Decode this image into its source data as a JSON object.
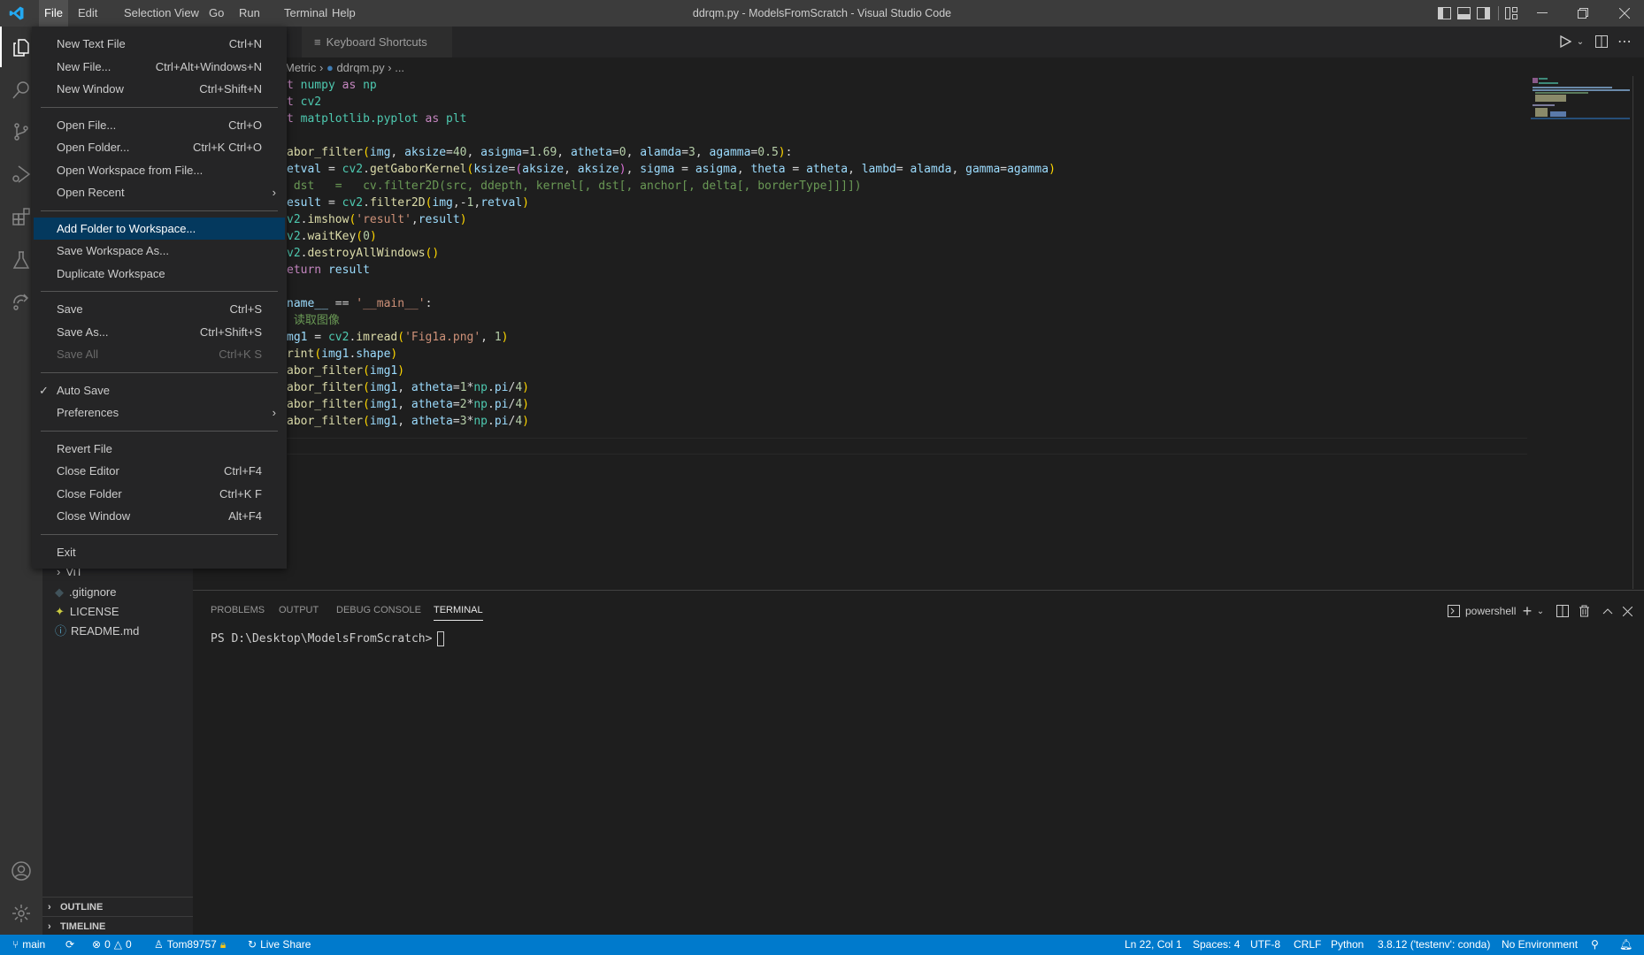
{
  "window": {
    "title": "ddrqm.py - ModelsFromScratch - Visual Studio Code"
  },
  "menubar": [
    "File",
    "Edit",
    "Selection",
    "View",
    "Go",
    "Run",
    "Terminal",
    "Help"
  ],
  "file_menu": [
    {
      "label": "New Text File",
      "shortcut": "Ctrl+N"
    },
    {
      "label": "New File...",
      "shortcut": "Ctrl+Alt+Windows+N"
    },
    {
      "label": "New Window",
      "shortcut": "Ctrl+Shift+N"
    },
    {
      "sep": true
    },
    {
      "label": "Open File...",
      "shortcut": "Ctrl+O"
    },
    {
      "label": "Open Folder...",
      "shortcut": "Ctrl+K Ctrl+O"
    },
    {
      "label": "Open Workspace from File...",
      "shortcut": ""
    },
    {
      "label": "Open Recent",
      "shortcut": "",
      "submenu": true
    },
    {
      "sep": true
    },
    {
      "label": "Add Folder to Workspace...",
      "shortcut": "",
      "highlighted": true
    },
    {
      "label": "Save Workspace As...",
      "shortcut": ""
    },
    {
      "label": "Duplicate Workspace",
      "shortcut": ""
    },
    {
      "sep": true
    },
    {
      "label": "Save",
      "shortcut": "Ctrl+S"
    },
    {
      "label": "Save As...",
      "shortcut": "Ctrl+Shift+S"
    },
    {
      "label": "Save All",
      "shortcut": "Ctrl+K S",
      "disabled": true
    },
    {
      "sep": true
    },
    {
      "label": "Auto Save",
      "shortcut": "",
      "checked": true
    },
    {
      "label": "Preferences",
      "shortcut": "",
      "submenu": true
    },
    {
      "sep": true
    },
    {
      "label": "Revert File",
      "shortcut": ""
    },
    {
      "label": "Close Editor",
      "shortcut": "Ctrl+F4"
    },
    {
      "label": "Close Folder",
      "shortcut": "Ctrl+K F"
    },
    {
      "label": "Close Window",
      "shortcut": "Alt+F4"
    },
    {
      "sep": true
    },
    {
      "label": "Exit",
      "shortcut": ""
    }
  ],
  "sidebar": {
    "items": [
      {
        "label": "ViT",
        "icon": "chevron-right-icon"
      },
      {
        "label": ".gitignore",
        "icon": "git-icon"
      },
      {
        "label": "LICENSE",
        "icon": "license-icon"
      },
      {
        "label": "README.md",
        "icon": "info-icon"
      }
    ],
    "sections": [
      "OUTLINE",
      "TIMELINE"
    ]
  },
  "editor": {
    "tab": "Keyboard Shortcuts",
    "breadcrumb": [
      "Metric",
      "ddrqm.py",
      "..."
    ],
    "lines": [
      [
        [
          "t ",
          "kw"
        ],
        [
          "numpy",
          "mod"
        ],
        [
          " as ",
          "kw"
        ],
        [
          "np",
          "mod"
        ]
      ],
      [
        [
          "t ",
          "kw"
        ],
        [
          "cv2",
          "mod"
        ]
      ],
      [
        [
          "t ",
          "kw"
        ],
        [
          "matplotlib.pyplot",
          "mod"
        ],
        [
          " as ",
          "kw"
        ],
        [
          "plt",
          "mod"
        ]
      ],
      [],
      [
        [
          "abor_filter",
          "fn"
        ],
        [
          "(",
          "b1"
        ],
        [
          "img",
          "var"
        ],
        [
          ", ",
          "op"
        ],
        [
          "aksize",
          "var"
        ],
        [
          "=",
          "op"
        ],
        [
          "40",
          "num"
        ],
        [
          ", ",
          "op"
        ],
        [
          "asigma",
          "var"
        ],
        [
          "=",
          "op"
        ],
        [
          "1.69",
          "num"
        ],
        [
          ", ",
          "op"
        ],
        [
          "atheta",
          "var"
        ],
        [
          "=",
          "op"
        ],
        [
          "0",
          "num"
        ],
        [
          ", ",
          "op"
        ],
        [
          "alamda",
          "var"
        ],
        [
          "=",
          "op"
        ],
        [
          "3",
          "num"
        ],
        [
          ", ",
          "op"
        ],
        [
          "agamma",
          "var"
        ],
        [
          "=",
          "op"
        ],
        [
          "0.5",
          "num"
        ],
        [
          ")",
          "b1"
        ],
        [
          ":",
          "op"
        ]
      ],
      [
        [
          "etval",
          "var"
        ],
        [
          " = ",
          "op"
        ],
        [
          "cv2",
          "mod"
        ],
        [
          ".",
          "op"
        ],
        [
          "getGaborKernel",
          "fn"
        ],
        [
          "(",
          "b1"
        ],
        [
          "ksize",
          "var"
        ],
        [
          "=",
          "op"
        ],
        [
          "(",
          "b2"
        ],
        [
          "aksize",
          "var"
        ],
        [
          ", ",
          "op"
        ],
        [
          "aksize",
          "var"
        ],
        [
          ")",
          "b2"
        ],
        [
          ", ",
          "op"
        ],
        [
          "sigma",
          "var"
        ],
        [
          " = ",
          "op"
        ],
        [
          "asigma",
          "var"
        ],
        [
          ", ",
          "op"
        ],
        [
          "theta",
          "var"
        ],
        [
          " = ",
          "op"
        ],
        [
          "atheta",
          "var"
        ],
        [
          ", ",
          "op"
        ],
        [
          "lambd",
          "var"
        ],
        [
          "= ",
          "op"
        ],
        [
          "alamda",
          "var"
        ],
        [
          ", ",
          "op"
        ],
        [
          "gamma",
          "var"
        ],
        [
          "=",
          "op"
        ],
        [
          "agamma",
          "var"
        ],
        [
          ")",
          "b1"
        ]
      ],
      [
        [
          " dst   =   cv.filter2D(src, ddepth, kernel[, dst[, anchor[, delta[, borderType]]]])",
          "com"
        ]
      ],
      [
        [
          "esult",
          "var"
        ],
        [
          " = ",
          "op"
        ],
        [
          "cv2",
          "mod"
        ],
        [
          ".",
          "op"
        ],
        [
          "filter2D",
          "fn"
        ],
        [
          "(",
          "b1"
        ],
        [
          "img",
          "var"
        ],
        [
          ",-",
          "op"
        ],
        [
          "1",
          "num"
        ],
        [
          ",",
          "op"
        ],
        [
          "retval",
          "var"
        ],
        [
          ")",
          "b1"
        ]
      ],
      [
        [
          "v2",
          "mod"
        ],
        [
          ".",
          "op"
        ],
        [
          "imshow",
          "fn"
        ],
        [
          "(",
          "b1"
        ],
        [
          "'result'",
          "str"
        ],
        [
          ",",
          "op"
        ],
        [
          "result",
          "var"
        ],
        [
          ")",
          "b1"
        ]
      ],
      [
        [
          "v2",
          "mod"
        ],
        [
          ".",
          "op"
        ],
        [
          "waitKey",
          "fn"
        ],
        [
          "(",
          "b1"
        ],
        [
          "0",
          "num"
        ],
        [
          ")",
          "b1"
        ]
      ],
      [
        [
          "v2",
          "mod"
        ],
        [
          ".",
          "op"
        ],
        [
          "destroyAllWindows",
          "fn"
        ],
        [
          "()",
          "b1"
        ]
      ],
      [
        [
          "eturn ",
          "kw"
        ],
        [
          "result",
          "var"
        ]
      ],
      [],
      [
        [
          "name__",
          "var"
        ],
        [
          " == ",
          "op"
        ],
        [
          "'__main__'",
          "str"
        ],
        [
          ":",
          "op"
        ]
      ],
      [
        [
          " 读取图像",
          "com"
        ]
      ],
      [
        [
          "mg1",
          "var"
        ],
        [
          " = ",
          "op"
        ],
        [
          "cv2",
          "mod"
        ],
        [
          ".",
          "op"
        ],
        [
          "imread",
          "fn"
        ],
        [
          "(",
          "b1"
        ],
        [
          "'Fig1a.png'",
          "str"
        ],
        [
          ", ",
          "op"
        ],
        [
          "1",
          "num"
        ],
        [
          ")",
          "b1"
        ]
      ],
      [
        [
          "rint",
          "fn"
        ],
        [
          "(",
          "b1"
        ],
        [
          "img1",
          "var"
        ],
        [
          ".",
          "op"
        ],
        [
          "shape",
          "var"
        ],
        [
          ")",
          "b1"
        ]
      ],
      [
        [
          "abor_filter",
          "fn"
        ],
        [
          "(",
          "b1"
        ],
        [
          "img1",
          "var"
        ],
        [
          ")",
          "b1"
        ]
      ],
      [
        [
          "abor_filter",
          "fn"
        ],
        [
          "(",
          "b1"
        ],
        [
          "img1",
          "var"
        ],
        [
          ", ",
          "op"
        ],
        [
          "atheta",
          "var"
        ],
        [
          "=",
          "op"
        ],
        [
          "1",
          "num"
        ],
        [
          "*",
          "op"
        ],
        [
          "np",
          "mod"
        ],
        [
          ".",
          "op"
        ],
        [
          "pi",
          "var"
        ],
        [
          "/",
          "op"
        ],
        [
          "4",
          "num"
        ],
        [
          ")",
          "b1"
        ]
      ],
      [
        [
          "abor_filter",
          "fn"
        ],
        [
          "(",
          "b1"
        ],
        [
          "img1",
          "var"
        ],
        [
          ", ",
          "op"
        ],
        [
          "atheta",
          "var"
        ],
        [
          "=",
          "op"
        ],
        [
          "2",
          "num"
        ],
        [
          "*",
          "op"
        ],
        [
          "np",
          "mod"
        ],
        [
          ".",
          "op"
        ],
        [
          "pi",
          "var"
        ],
        [
          "/",
          "op"
        ],
        [
          "4",
          "num"
        ],
        [
          ")",
          "b1"
        ]
      ],
      [
        [
          "abor_filter",
          "fn"
        ],
        [
          "(",
          "b1"
        ],
        [
          "img1",
          "var"
        ],
        [
          ", ",
          "op"
        ],
        [
          "atheta",
          "var"
        ],
        [
          "=",
          "op"
        ],
        [
          "3",
          "num"
        ],
        [
          "*",
          "op"
        ],
        [
          "np",
          "mod"
        ],
        [
          ".",
          "op"
        ],
        [
          "pi",
          "var"
        ],
        [
          "/",
          "op"
        ],
        [
          "4",
          "num"
        ],
        [
          ")",
          "b1"
        ]
      ]
    ]
  },
  "panel": {
    "tabs": [
      "PROBLEMS",
      "OUTPUT",
      "DEBUG CONSOLE",
      "TERMINAL"
    ],
    "active_tab": "TERMINAL",
    "shell": "powershell",
    "prompt": "PS D:\\Desktop\\ModelsFromScratch>"
  },
  "statusbar": {
    "branch": "main",
    "errors": "0",
    "warnings": "0",
    "user": "Tom89757",
    "live_share": "Live Share",
    "position": "Ln 22, Col 1",
    "spaces": "Spaces: 4",
    "encoding": "UTF-8",
    "eol": "CRLF",
    "language": "Python",
    "interpreter": "3.8.12 ('testenv': conda)",
    "environment": "No Environment"
  },
  "colors": {
    "statusbar": "#007acc",
    "menu_highlight": "#04395e",
    "titlebar": "#3c3c3c",
    "editor": "#1e1e1e"
  }
}
